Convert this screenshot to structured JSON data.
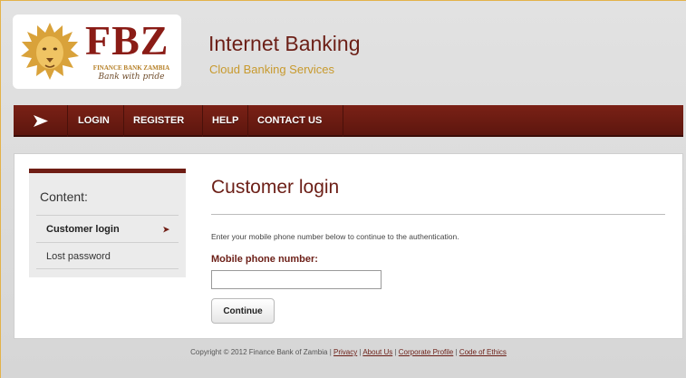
{
  "header": {
    "logo": {
      "brand": "FBZ",
      "bank_name": "FINANCE BANK ZAMBIA",
      "tagline": "Bank with pride"
    },
    "title": "Internet Banking",
    "subtitle": "Cloud Banking Services"
  },
  "nav": {
    "items": [
      {
        "label": "LOGIN"
      },
      {
        "label": "REGISTER"
      },
      {
        "label": "HELP"
      },
      {
        "label": "CONTACT US"
      }
    ]
  },
  "sidebar": {
    "title": "Content:",
    "items": [
      {
        "label": "Customer login",
        "active": true
      },
      {
        "label": "Lost password",
        "active": false
      }
    ]
  },
  "main": {
    "title": "Customer login",
    "description": "Enter your mobile phone number below to continue to the authentication.",
    "field_label": "Mobile phone number:",
    "field_value": "",
    "button_label": "Continue"
  },
  "footer": {
    "copyright": "Copyright © 2012 Finance Bank of Zambia |",
    "links": [
      {
        "label": "Privacy"
      },
      {
        "label": "About Us"
      },
      {
        "label": "Corporate Profile"
      },
      {
        "label": "Code of Ethics"
      }
    ]
  },
  "colors": {
    "brand_maroon": "#6c1f17",
    "brand_gold": "#c89a2e",
    "nav_bg": "#6a1a12"
  }
}
